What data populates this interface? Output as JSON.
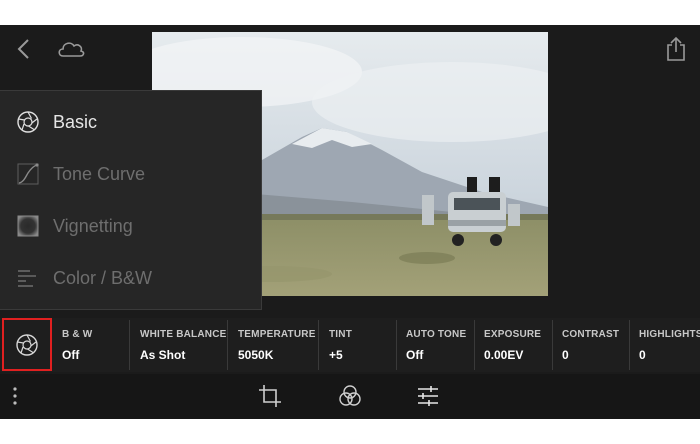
{
  "panel": {
    "items": [
      {
        "label": "Basic",
        "icon": "aperture-icon",
        "active": true
      },
      {
        "label": "Tone Curve",
        "icon": "tone-curve-icon",
        "active": false
      },
      {
        "label": "Vignetting",
        "icon": "vignette-icon",
        "active": false
      },
      {
        "label": "Color / B&W",
        "icon": "color-bw-icon",
        "active": false
      }
    ]
  },
  "adjustments": [
    {
      "label": "B & W",
      "value": "Off"
    },
    {
      "label": "WHITE BALANCE",
      "value": "As Shot"
    },
    {
      "label": "TEMPERATURE",
      "value": "5050K"
    },
    {
      "label": "TINT",
      "value": "+5"
    },
    {
      "label": "AUTO TONE",
      "value": "Off"
    },
    {
      "label": "EXPOSURE",
      "value": "0.00EV"
    },
    {
      "label": "CONTRAST",
      "value": "0"
    },
    {
      "label": "HIGHLIGHTS",
      "value": "0"
    }
  ],
  "colors": {
    "background": "#1b1b1b",
    "highlight_border": "#e02020"
  }
}
